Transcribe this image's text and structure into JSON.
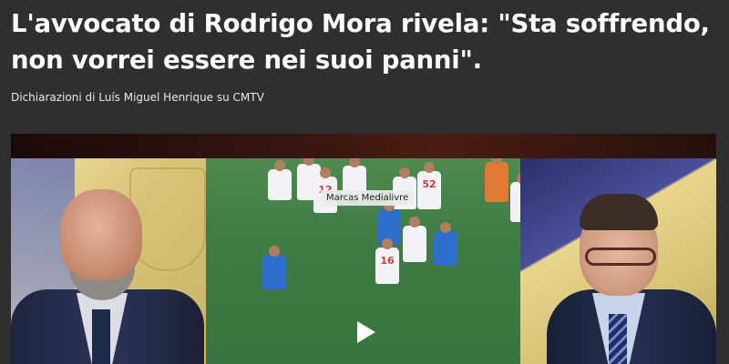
{
  "article": {
    "headline_line1": "L'avvocato di Rodrigo Mora rivela: \"Sta soffrendo,",
    "headline_line2": "non vorrei essere nei suoi panni\".",
    "subtitle": "Dichiarazioni di Luís Miguel Henrique su CMTV"
  },
  "video": {
    "caption_tag": "Marcas Medialivre",
    "play_icon": "play-icon",
    "jersey_numbers": [
      "12",
      "52",
      "16"
    ]
  },
  "colors": {
    "page_background": "#2f2f2f",
    "headline_text": "#ffffff",
    "pitch_green": "#3f7b43",
    "team_blue": "#2f6fcb"
  }
}
